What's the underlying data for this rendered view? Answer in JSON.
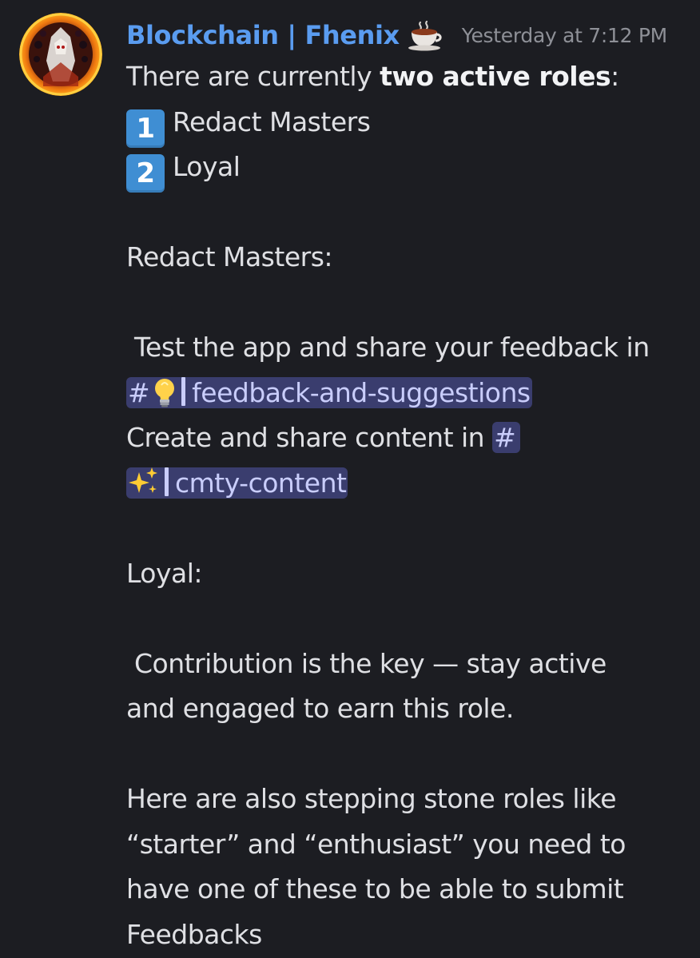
{
  "message": {
    "author": "Blockchain | Fhenix",
    "role_icon": "coffee-cup-icon",
    "timestamp": "Yesterday at 7:12 PM",
    "intro_prefix": "There are currently ",
    "intro_bold": "two active roles",
    "intro_suffix": ":",
    "roles": [
      {
        "number": "1",
        "name": "Redact Masters"
      },
      {
        "number": "2",
        "name": "Loyal"
      }
    ],
    "redact_heading": "Redact Masters:",
    "test_text": " Test the app and share your feedback in",
    "channel_feedback": {
      "hash": "#",
      "emoji": "lightbulb-icon",
      "name": "feedback-and-suggestions"
    },
    "create_text": "Create and share content in ",
    "channel_content": {
      "hash": "#",
      "emoji": "sparkles-icon",
      "name": "cmty-content"
    },
    "loyal_heading": "Loyal:",
    "contribution_line1": " Contribution is the key — stay active",
    "contribution_line2": "and engaged to earn this role.",
    "stepping_line1": "Here are also stepping stone roles like",
    "stepping_line2": "“starter” and “enthusiast” you need to",
    "stepping_line3": "have one of these to be able to submit",
    "stepping_line4": "Feedbacks"
  },
  "colors": {
    "background": "#1c1d22",
    "username": "#5a9cf0",
    "mention_bg": "#3a3d6e",
    "mention_text": "#c9cdfb",
    "keycap": "#3f8ed3"
  }
}
